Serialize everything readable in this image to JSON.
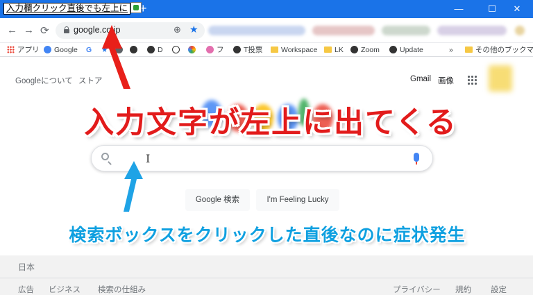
{
  "ime": {
    "composing_text": "入力欄クリック直後でも左上に"
  },
  "window": {
    "tab_close": "✕",
    "new_tab": "+",
    "minimize": "—",
    "maximize": "☐",
    "close": "✕"
  },
  "toolbar": {
    "back": "←",
    "forward": "→",
    "reload": "⟳",
    "url": "google.co.jp",
    "zoom_icon": "⊕",
    "bookmark_star": "★"
  },
  "bookmarks": {
    "items": [
      {
        "label": "アプリ"
      },
      {
        "label": "Google"
      },
      {
        "label": "G"
      },
      {
        "label": "D"
      },
      {
        "label": "フ"
      },
      {
        "label": "T投票"
      },
      {
        "label": "Workspace"
      },
      {
        "label": "LK"
      },
      {
        "label": "Zoom"
      },
      {
        "label": "Update"
      }
    ],
    "overflow": "»",
    "other": "その他のブックマーク"
  },
  "page": {
    "top_left": [
      "Googleについて",
      "ストア"
    ],
    "gmail": "Gmail",
    "images": "画像",
    "search_cursor": "I",
    "buttons": {
      "search": "Google 検索",
      "lucky": "I'm Feeling Lucky"
    },
    "footer": {
      "country": "日本",
      "left_links": [
        "広告",
        "ビジネス",
        "検索の仕組み"
      ],
      "right_links": [
        "プライバシー",
        "規約",
        "設定"
      ]
    }
  },
  "annotations": {
    "headline": "入力文字が左上に出てくる",
    "subline": "検索ボックスをクリックした直後なのに症状発生",
    "headline_color": "#e21b1b",
    "subline_color": "#0fa0e0"
  },
  "colors": {
    "chrome_blue": "#1a73e8",
    "mic_blue": "#4285f4",
    "arrow_red": "#e8201a",
    "arrow_blue": "#1fa3e6"
  }
}
